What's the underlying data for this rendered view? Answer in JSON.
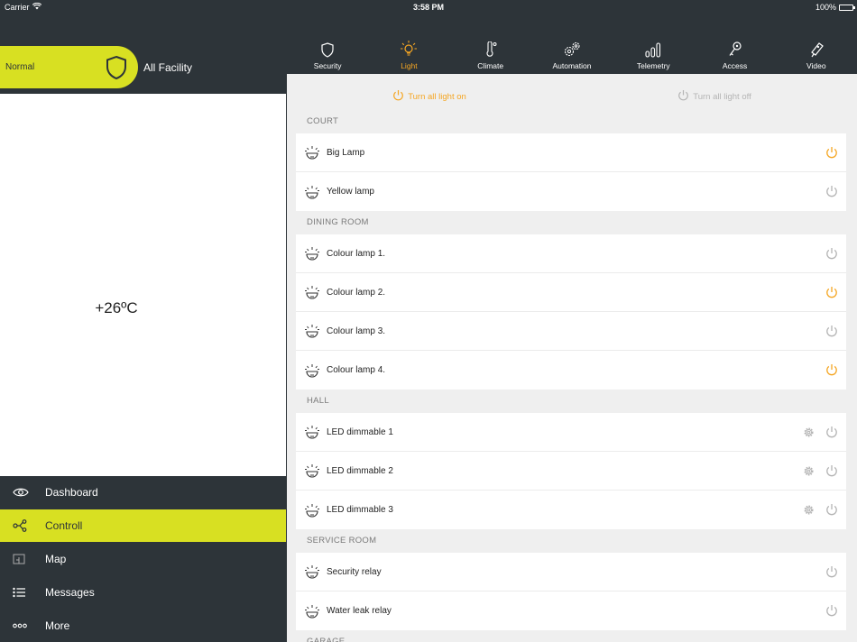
{
  "status_bar": {
    "carrier": "Carrier",
    "time": "3:58 PM",
    "battery": "100%"
  },
  "left_panel": {
    "mode": "Normal",
    "facility": "All Facility",
    "temperature": "+26ºC",
    "nav": [
      {
        "label": "Dashboard",
        "icon": "eye-icon",
        "active": false
      },
      {
        "label": "Controll",
        "icon": "share-nodes-icon",
        "active": true
      },
      {
        "label": "Map",
        "icon": "map-icon",
        "active": false
      },
      {
        "label": "Messages",
        "icon": "list-icon",
        "active": false
      },
      {
        "label": "More",
        "icon": "more-dots-icon",
        "active": false
      }
    ]
  },
  "tabs": [
    {
      "label": "Security",
      "icon": "shield-icon",
      "active": false
    },
    {
      "label": "Light",
      "icon": "bulb-icon",
      "active": true
    },
    {
      "label": "Climate",
      "icon": "thermometer-icon",
      "active": false
    },
    {
      "label": "Automation",
      "icon": "gears-icon",
      "active": false
    },
    {
      "label": "Telemetry",
      "icon": "signal-bars-icon",
      "active": false
    },
    {
      "label": "Access",
      "icon": "key-icon",
      "active": false
    },
    {
      "label": "Video",
      "icon": "camera-icon",
      "active": false
    }
  ],
  "actions": {
    "all_on": "Turn all light on",
    "all_off": "Turn all light off"
  },
  "colors": {
    "accent_yellow": "#d8e022",
    "active_orange": "#f5a623",
    "dark": "#2d3439",
    "inactive_gray": "#b4b4b4"
  },
  "sections": [
    {
      "title": "COURT",
      "items": [
        {
          "name": "Big Lamp",
          "on": true,
          "settings": false
        },
        {
          "name": "Yellow lamp",
          "on": false,
          "settings": false
        }
      ]
    },
    {
      "title": "DINING ROOM",
      "items": [
        {
          "name": "Colour lamp 1.",
          "on": false,
          "settings": false
        },
        {
          "name": "Colour lamp 2.",
          "on": true,
          "settings": false
        },
        {
          "name": "Colour lamp 3.",
          "on": false,
          "settings": false
        },
        {
          "name": "Colour lamp 4.",
          "on": true,
          "settings": false
        }
      ]
    },
    {
      "title": "HALL",
      "items": [
        {
          "name": "LED dimmable 1",
          "on": false,
          "settings": true
        },
        {
          "name": "LED dimmable 2",
          "on": false,
          "settings": true
        },
        {
          "name": "LED dimmable 3",
          "on": false,
          "settings": true
        }
      ]
    },
    {
      "title": "SERVICE ROOM",
      "items": [
        {
          "name": "Security relay",
          "on": false,
          "settings": false
        },
        {
          "name": "Water leak relay",
          "on": false,
          "settings": false
        }
      ]
    },
    {
      "title": "GARAGE",
      "items": []
    }
  ]
}
